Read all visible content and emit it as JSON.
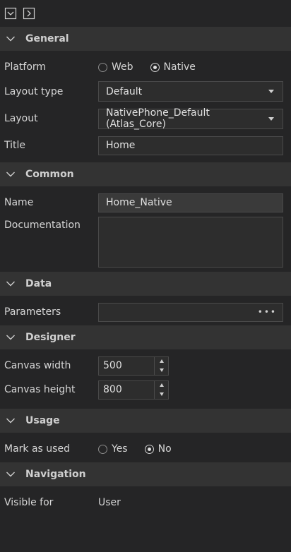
{
  "sections": {
    "general": "General",
    "common": "Common",
    "data": "Data",
    "designer": "Designer",
    "usage": "Usage",
    "navigation": "Navigation"
  },
  "general": {
    "platform_label": "Platform",
    "platform_web": "Web",
    "platform_native": "Native",
    "platform_selected": "Native",
    "layout_type_label": "Layout type",
    "layout_type_value": "Default",
    "layout_label": "Layout",
    "layout_value": "NativePhone_Default (Atlas_Core)",
    "title_label": "Title",
    "title_value": "Home"
  },
  "common": {
    "name_label": "Name",
    "name_value": "Home_Native",
    "documentation_label": "Documentation",
    "documentation_value": ""
  },
  "data": {
    "parameters_label": "Parameters",
    "parameters_button": "•••"
  },
  "designer": {
    "canvas_width_label": "Canvas width",
    "canvas_width_value": "500",
    "canvas_height_label": "Canvas height",
    "canvas_height_value": "800"
  },
  "usage": {
    "mark_used_label": "Mark as used",
    "yes": "Yes",
    "no": "No",
    "selected": "No"
  },
  "navigation": {
    "visible_for_label": "Visible for",
    "visible_for_value": "User"
  }
}
